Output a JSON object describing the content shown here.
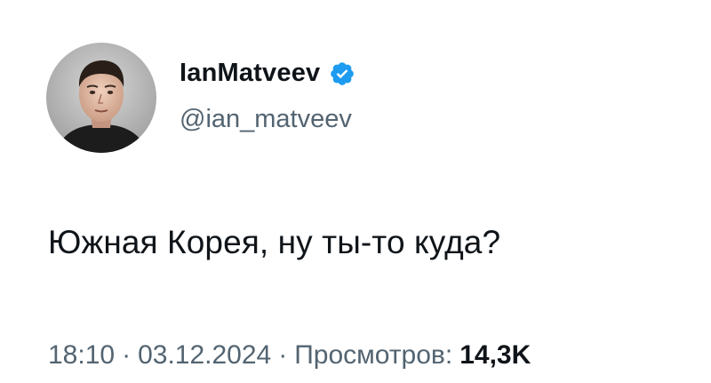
{
  "author": {
    "display_name": "IanMatveev",
    "handle": "@ian_matveev",
    "verified_icon": "verified-badge-icon",
    "verified_color": "#1d9bf0"
  },
  "tweet": {
    "text": "Южная Корея, ну ты-то куда?"
  },
  "meta": {
    "time": "18:10",
    "separator": "·",
    "date": "03.12.2024",
    "views_label": "Просмотров:",
    "views_count": "14,3K"
  },
  "colors": {
    "text_primary": "#0f1419",
    "text_secondary": "#536471",
    "background": "#ffffff"
  }
}
